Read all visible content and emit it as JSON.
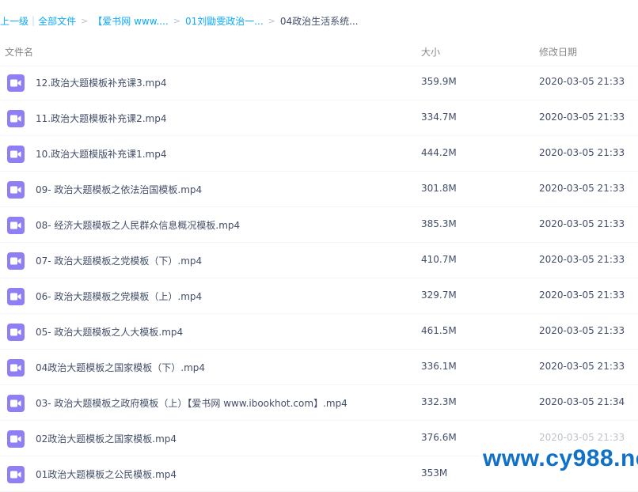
{
  "breadcrumb": {
    "up_label": "上一级",
    "separator": "|",
    "all_files": "全部文件",
    "chevron": ">",
    "crumbs": [
      "【爱书网 www....",
      "01刘勖雯政治一...",
      "04政治生活系统..."
    ]
  },
  "columns": {
    "name": "文件名",
    "size": "大小",
    "date": "修改日期"
  },
  "files": [
    {
      "name": "12.政治大题模板补充课3.mp4",
      "size": "359.9M",
      "date": "2020-03-05 21:33",
      "icon": "video-file-icon"
    },
    {
      "name": "11.政治大题模板补充课2.mp4",
      "size": "334.7M",
      "date": "2020-03-05 21:33",
      "icon": "video-file-icon"
    },
    {
      "name": "10.政治大题模版补充课1.mp4",
      "size": "444.2M",
      "date": "2020-03-05 21:33",
      "icon": "video-file-icon"
    },
    {
      "name": "09- 政治大题模板之依法治国模板.mp4",
      "size": "301.8M",
      "date": "2020-03-05 21:33",
      "icon": "video-file-icon"
    },
    {
      "name": "08- 经济大题模板之人民群众信息概况模板.mp4",
      "size": "385.3M",
      "date": "2020-03-05 21:33",
      "icon": "video-file-icon"
    },
    {
      "name": "07- 政治大题模板之党模板（下）.mp4",
      "size": "410.7M",
      "date": "2020-03-05 21:33",
      "icon": "video-file-icon"
    },
    {
      "name": "06- 政治大题模板之党模板（上）.mp4",
      "size": "329.7M",
      "date": "2020-03-05 21:33",
      "icon": "video-file-icon"
    },
    {
      "name": "05- 政治大题模板之人大模板.mp4",
      "size": "461.5M",
      "date": "2020-03-05 21:33",
      "icon": "video-file-icon"
    },
    {
      "name": "04政治大题模板之国家模板（下）.mp4",
      "size": "336.1M",
      "date": "2020-03-05 21:33",
      "icon": "video-file-icon"
    },
    {
      "name": "03- 政治大题模板之政府模板（上）【爱书网 www.ibookhot.com】.mp4",
      "size": "332.3M",
      "date": "2020-03-05 21:34",
      "icon": "video-file-icon"
    },
    {
      "name": "02政治大题模板之国家模板.mp4",
      "size": "376.6M",
      "date": "2020-03-05 21:33",
      "icon": "video-file-icon"
    },
    {
      "name": "01政治大题模板之公民模板.mp4",
      "size": "353M",
      "date": "",
      "icon": "video-file-icon"
    }
  ],
  "watermark": "www.cy988.net",
  "colors": {
    "link": "#09aaff",
    "icon_bg": "#8f7ff5",
    "watermark": "#1170c8"
  }
}
